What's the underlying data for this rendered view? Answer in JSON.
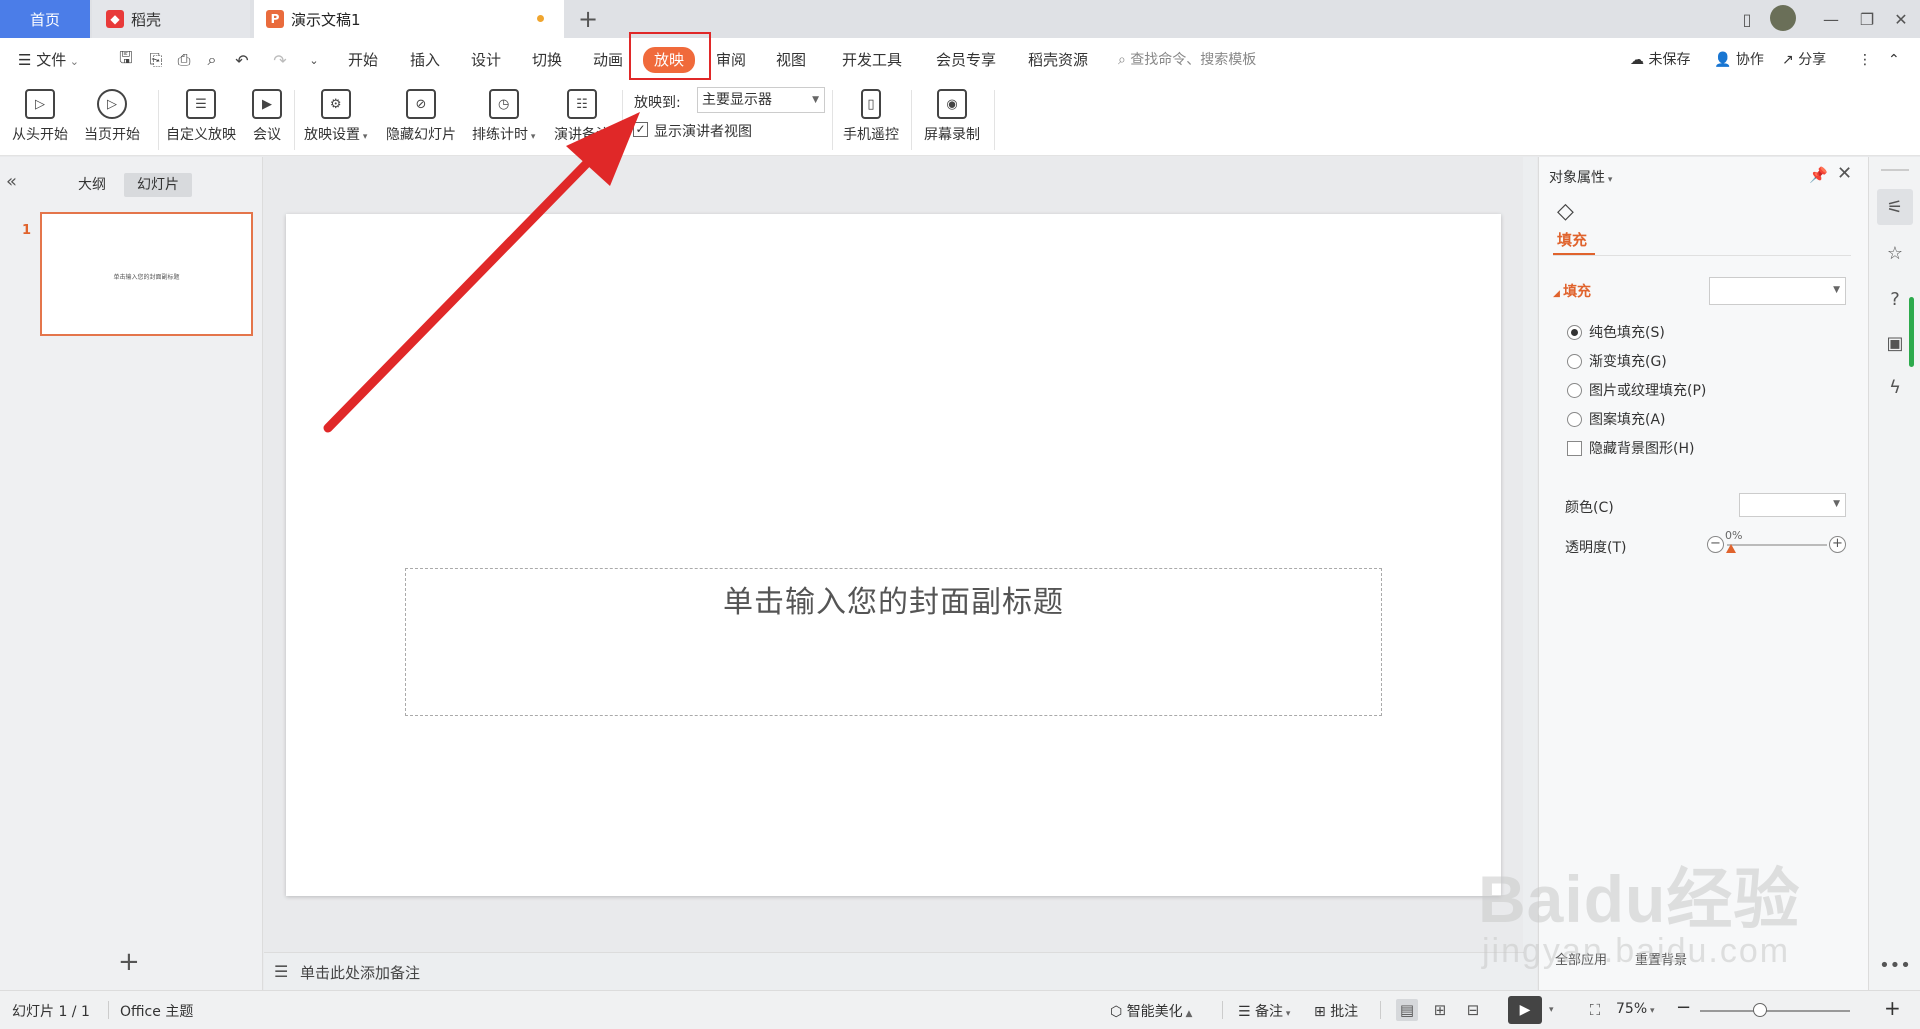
{
  "tabs": {
    "home": "首页",
    "daoke": "稻壳",
    "doc": "演示文稿1"
  },
  "menu": {
    "file": "文件",
    "items": [
      "开始",
      "插入",
      "设计",
      "切换",
      "动画",
      "放映",
      "审阅",
      "视图",
      "开发工具",
      "会员专享",
      "稻壳资源"
    ],
    "search_placeholder": "查找命令、搜索模板",
    "unsaved": "未保存",
    "collab": "协作",
    "share": "分享"
  },
  "ribbon": {
    "from_start": "从头开始",
    "from_current": "当页开始",
    "custom_show": "自定义放映",
    "meeting": "会议",
    "show_settings": "放映设置",
    "hide_slide": "隐藏幻灯片",
    "rehearse": "排练计时",
    "speaker_notes": "演讲备注",
    "play_to_label": "放映到:",
    "play_to_value": "主要显示器",
    "presenter_view": "显示演讲者视图",
    "phone_remote": "手机遥控",
    "screen_record": "屏幕录制"
  },
  "left_panel": {
    "tab_outline": "大纲",
    "tab_slides": "幻灯片",
    "slide_number": "1",
    "thumb_text": "单击输入您的封面副标题"
  },
  "slide": {
    "subtitle_placeholder": "单击输入您的封面副标题"
  },
  "notes": {
    "placeholder": "单击此处添加备注"
  },
  "props": {
    "title": "对象属性",
    "tab_fill": "填充",
    "section_fill": "填充",
    "options": [
      "纯色填充(S)",
      "渐变填充(G)",
      "图片或纹理填充(P)",
      "图案填充(A)"
    ],
    "selected_option": 0,
    "hide_bg": "隐藏背景图形(H)",
    "color_label": "颜色(C)",
    "transparency_label": "透明度(T)",
    "transparency_value": "0%",
    "apply_all": "全部应用",
    "reset_bg": "重置背景"
  },
  "status": {
    "slide_info": "幻灯片 1 / 1",
    "theme": "Office 主题",
    "beautify": "智能美化",
    "notes": "备注",
    "comments": "批注",
    "zoom": "75%"
  },
  "watermark": {
    "logo": "Baidu经验",
    "url": "jingyan.baidu.com"
  },
  "colors": {
    "accent": "#f06a3b",
    "home_tab": "#4b7de8",
    "annotation_red": "#e02828"
  }
}
